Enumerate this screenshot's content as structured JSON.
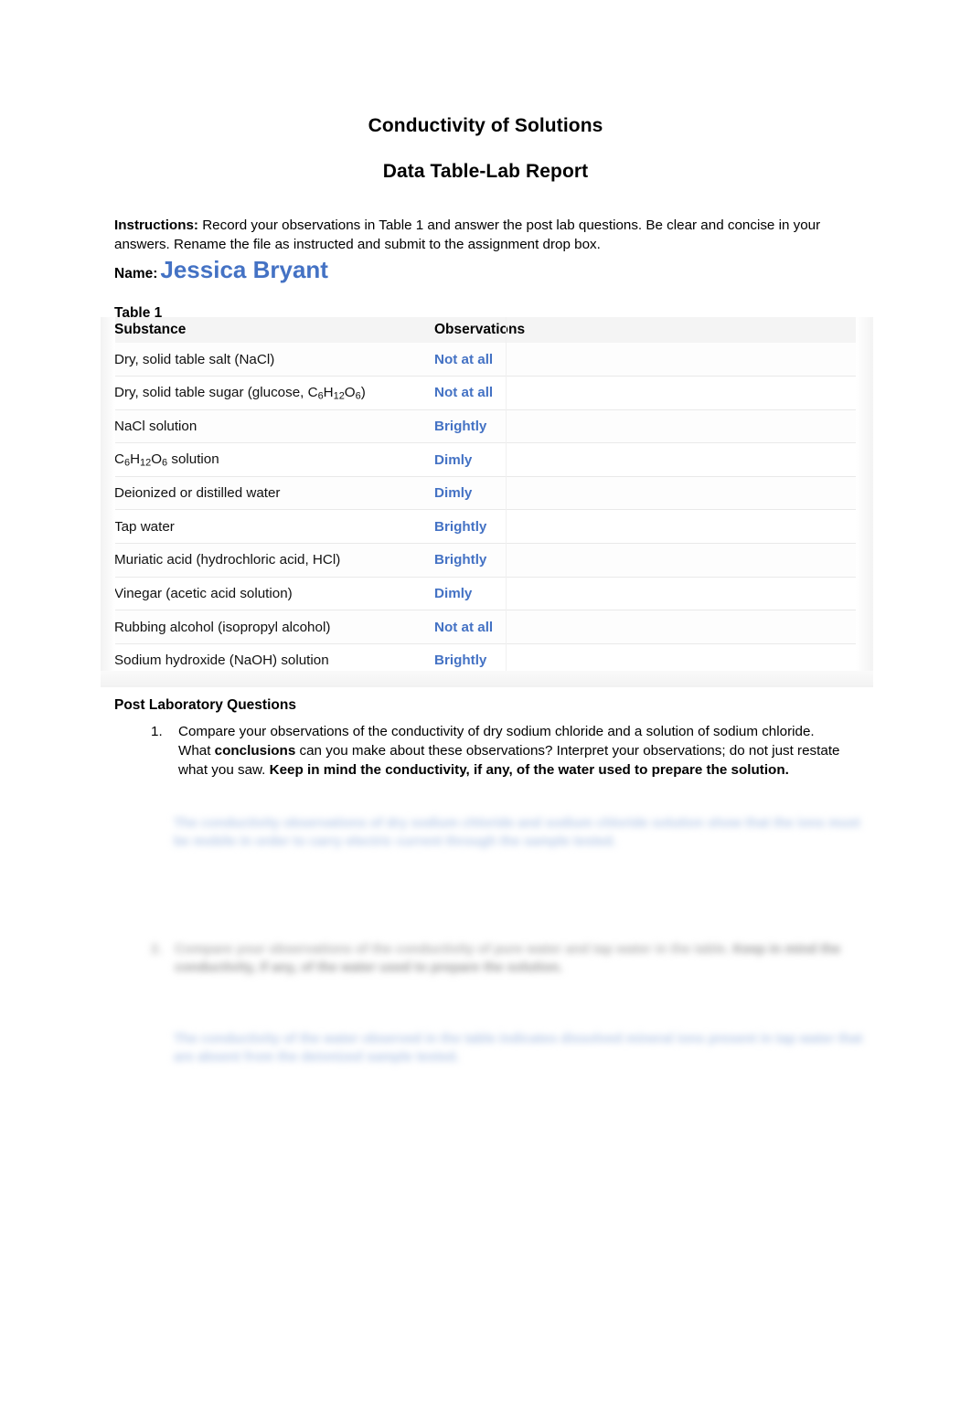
{
  "document": {
    "title_main": "Conductivity of Solutions",
    "title_sub": "Data Table-Lab Report",
    "instructions_label": "Instructions:",
    "instructions_text": " Record your observations in Table 1 and answer the post lab questions.  Be clear and concise in your answers.  Rename the file as instructed and submit to the assignment drop box.",
    "name_label": "Name:",
    "name_value": "Jessica Bryant"
  },
  "table": {
    "caption": "Table 1",
    "headers": {
      "substance": "Substance",
      "observations": "Observations"
    },
    "rows": [
      {
        "substance": "Dry, solid table salt (NaCl)",
        "observation": "Not at all"
      },
      {
        "substance_html": "Dry, solid table sugar (glucose, C<sub>6</sub>H<sub>12</sub>O<sub>6</sub>)",
        "substance": "Dry, solid table sugar (glucose, C6H12O6)",
        "observation": "Not at all"
      },
      {
        "substance": "NaCl solution",
        "observation": "Brightly"
      },
      {
        "substance_html": "C<sub>6</sub>H<sub>12</sub>O<sub>6</sub> solution",
        "substance": "C6H12O6 solution",
        "observation": "Dimly"
      },
      {
        "substance": "Deionized or distilled water",
        "observation": "Dimly"
      },
      {
        "substance": "Tap water",
        "observation": "Brightly"
      },
      {
        "substance": "Muriatic acid (hydrochloric acid, HCl)",
        "observation": "Brightly"
      },
      {
        "substance": "Vinegar (acetic acid solution)",
        "observation": "Dimly"
      },
      {
        "substance": "Rubbing alcohol (isopropyl alcohol)",
        "observation": "Not at all"
      },
      {
        "substance": "Sodium hydroxide (NaOH) solution",
        "observation": "Brightly"
      }
    ]
  },
  "post_lab": {
    "heading": "Post Laboratory Questions",
    "question_1": {
      "number": "1.",
      "part_a": "Compare your observations of the conductivity of dry sodium chloride and a solution of sodium chloride. What ",
      "bold_a": "conclusions",
      "part_b": " can you make about these observations? Interpret your observations; do not just restate what you saw.   ",
      "bold_b": "Keep in mind the conductivity, if any, of the water used to prepare the solution."
    },
    "answer_1_redacted": "The conductivity observations of dry sodium chloride and sodium chloride solution show that the ions must be mobile in order to carry electric current through the sample tested.",
    "question_2_redacted": {
      "number": "2.",
      "text": "Compare your observations of the conductivity of pure water and tap water in the table. ",
      "bold": "Keep in mind the conductivity, if any, of the water used to prepare the solution."
    },
    "answer_2_redacted": "The conductivity of the water observed in the table indicates dissolved mineral ions present in tap water that are absent from the deionized sample tested."
  },
  "colors": {
    "accent_blue": "#4472C4",
    "text_black": "#000000",
    "redacted_blue": "#b9cbe8",
    "redacted_gray": "#b4b4b4"
  }
}
